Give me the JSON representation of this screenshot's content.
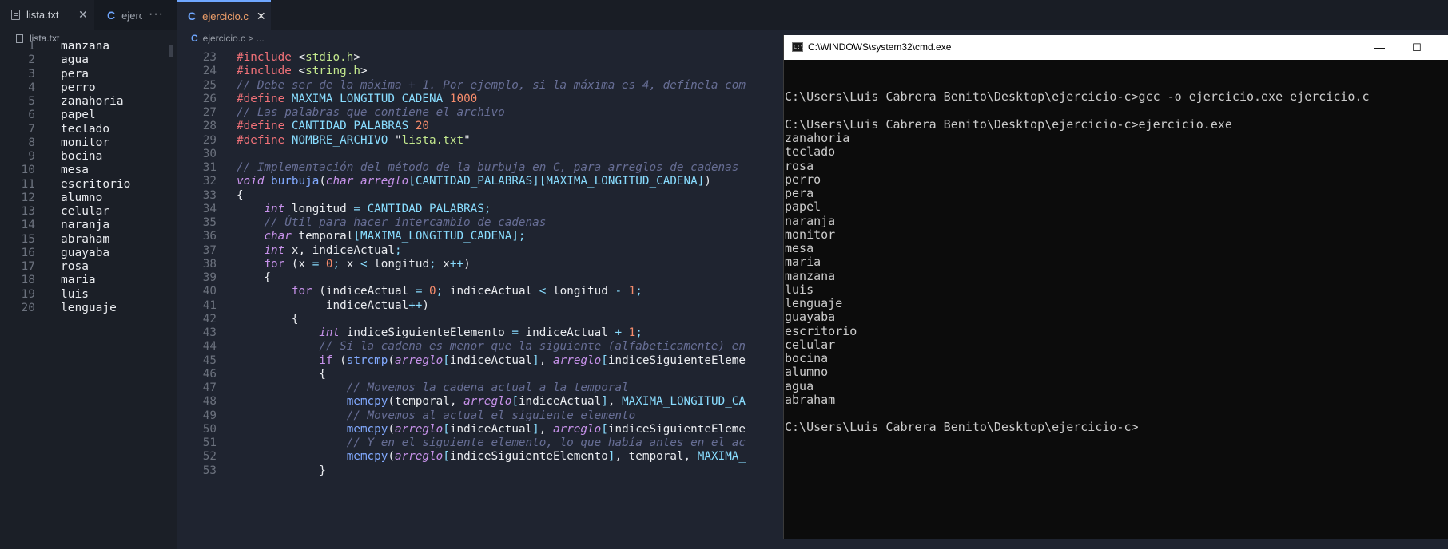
{
  "left_tabs": {
    "active_label": "lista.txt",
    "inactive_label": "ejerc",
    "more_label": "···",
    "close_glyph": "✕"
  },
  "left_breadcrumb": "lista.txt",
  "lista": [
    {
      "n": "1",
      "t": "manzana"
    },
    {
      "n": "2",
      "t": "agua"
    },
    {
      "n": "3",
      "t": "pera"
    },
    {
      "n": "4",
      "t": "perro"
    },
    {
      "n": "5",
      "t": "zanahoria"
    },
    {
      "n": "6",
      "t": "papel"
    },
    {
      "n": "7",
      "t": "teclado"
    },
    {
      "n": "8",
      "t": "monitor"
    },
    {
      "n": "9",
      "t": "bocina"
    },
    {
      "n": "10",
      "t": "mesa"
    },
    {
      "n": "11",
      "t": "escritorio"
    },
    {
      "n": "12",
      "t": "alumno"
    },
    {
      "n": "13",
      "t": "celular"
    },
    {
      "n": "14",
      "t": "naranja"
    },
    {
      "n": "15",
      "t": "abraham"
    },
    {
      "n": "16",
      "t": "guayaba"
    },
    {
      "n": "17",
      "t": "rosa"
    },
    {
      "n": "18",
      "t": "maria"
    },
    {
      "n": "19",
      "t": "luis"
    },
    {
      "n": "20",
      "t": "lenguaje"
    }
  ],
  "editor_tab": {
    "label": "ejercicio.c",
    "close_glyph": "✕"
  },
  "editor_breadcrumb": "ejercicio.c > ...",
  "code_lines": [
    {
      "n": "23",
      "tokens": [
        [
          "pp",
          "#"
        ],
        [
          "pp",
          "include"
        ],
        [
          "var",
          " <"
        ],
        [
          "hdr",
          "stdio.h"
        ],
        [
          "var",
          ">"
        ]
      ]
    },
    {
      "n": "24",
      "tokens": [
        [
          "pp",
          "#"
        ],
        [
          "pp",
          "include"
        ],
        [
          "var",
          " <"
        ],
        [
          "hdr",
          "string.h"
        ],
        [
          "var",
          ">"
        ]
      ]
    },
    {
      "n": "25",
      "tokens": [
        [
          "cm",
          "// Debe ser de la máxima + 1. Por ejemplo, si la máxima es 4, defínela com"
        ]
      ]
    },
    {
      "n": "26",
      "tokens": [
        [
          "pp",
          "#"
        ],
        [
          "pp",
          "define"
        ],
        [
          "var",
          " "
        ],
        [
          "mac",
          "MAXIMA_LONGITUD_CADENA"
        ],
        [
          "var",
          " "
        ],
        [
          "num",
          "1000"
        ]
      ]
    },
    {
      "n": "27",
      "tokens": [
        [
          "cm",
          "// Las palabras que contiene el archivo"
        ]
      ]
    },
    {
      "n": "28",
      "tokens": [
        [
          "pp",
          "#"
        ],
        [
          "pp",
          "define"
        ],
        [
          "var",
          " "
        ],
        [
          "mac",
          "CANTIDAD_PALABRAS"
        ],
        [
          "var",
          " "
        ],
        [
          "num",
          "20"
        ]
      ]
    },
    {
      "n": "29",
      "tokens": [
        [
          "pp",
          "#"
        ],
        [
          "pp",
          "define"
        ],
        [
          "var",
          " "
        ],
        [
          "mac",
          "NOMBRE_ARCHIVO"
        ],
        [
          "var",
          " \""
        ],
        [
          "str",
          "lista.txt"
        ],
        [
          "var",
          "\""
        ]
      ]
    },
    {
      "n": "30",
      "tokens": []
    },
    {
      "n": "31",
      "tokens": [
        [
          "cm",
          "// Implementación del método de la burbuja en C, para arreglos de cadenas"
        ]
      ]
    },
    {
      "n": "32",
      "tokens": [
        [
          "ty",
          "void"
        ],
        [
          "var",
          " "
        ],
        [
          "fn",
          "burbuja"
        ],
        [
          "var",
          "("
        ],
        [
          "ty",
          "char"
        ],
        [
          "var",
          " "
        ],
        [
          "ty",
          "arreglo"
        ],
        [
          "op",
          "["
        ],
        [
          "mac",
          "CANTIDAD_PALABRAS"
        ],
        [
          "op",
          "]["
        ],
        [
          "mac",
          "MAXIMA_LONGITUD_CADENA"
        ],
        [
          "op",
          "]"
        ],
        [
          "var",
          ")"
        ]
      ]
    },
    {
      "n": "33",
      "tokens": [
        [
          "var",
          "{"
        ]
      ]
    },
    {
      "n": "34",
      "tokens": [
        [
          "var",
          "    "
        ],
        [
          "ty",
          "int"
        ],
        [
          "var",
          " longitud "
        ],
        [
          "op",
          "="
        ],
        [
          "var",
          " "
        ],
        [
          "mac",
          "CANTIDAD_PALABRAS"
        ],
        [
          "op",
          ";"
        ]
      ]
    },
    {
      "n": "35",
      "tokens": [
        [
          "var",
          "    "
        ],
        [
          "cm",
          "// Útil para hacer intercambio de cadenas"
        ]
      ]
    },
    {
      "n": "36",
      "tokens": [
        [
          "var",
          "    "
        ],
        [
          "ty",
          "char"
        ],
        [
          "var",
          " temporal"
        ],
        [
          "op",
          "["
        ],
        [
          "mac",
          "MAXIMA_LONGITUD_CADENA"
        ],
        [
          "op",
          "];"
        ]
      ]
    },
    {
      "n": "37",
      "tokens": [
        [
          "var",
          "    "
        ],
        [
          "ty",
          "int"
        ],
        [
          "var",
          " x, indiceActual"
        ],
        [
          "op",
          ";"
        ]
      ]
    },
    {
      "n": "38",
      "tokens": [
        [
          "var",
          "    "
        ],
        [
          "kw",
          "for"
        ],
        [
          "var",
          " (x "
        ],
        [
          "op",
          "="
        ],
        [
          "var",
          " "
        ],
        [
          "num",
          "0"
        ],
        [
          "op",
          ";"
        ],
        [
          "var",
          " x "
        ],
        [
          "op",
          "<"
        ],
        [
          "var",
          " longitud"
        ],
        [
          "op",
          ";"
        ],
        [
          "var",
          " x"
        ],
        [
          "op",
          "++"
        ],
        [
          "var",
          ")"
        ]
      ]
    },
    {
      "n": "39",
      "tokens": [
        [
          "var",
          "    {"
        ]
      ]
    },
    {
      "n": "40",
      "tokens": [
        [
          "var",
          "        "
        ],
        [
          "kw",
          "for"
        ],
        [
          "var",
          " (indiceActual "
        ],
        [
          "op",
          "="
        ],
        [
          "var",
          " "
        ],
        [
          "num",
          "0"
        ],
        [
          "op",
          ";"
        ],
        [
          "var",
          " indiceActual "
        ],
        [
          "op",
          "<"
        ],
        [
          "var",
          " longitud "
        ],
        [
          "op",
          "-"
        ],
        [
          "var",
          " "
        ],
        [
          "num",
          "1"
        ],
        [
          "op",
          ";"
        ]
      ]
    },
    {
      "n": "41",
      "tokens": [
        [
          "var",
          "             indiceActual"
        ],
        [
          "op",
          "++"
        ],
        [
          "var",
          ")"
        ]
      ]
    },
    {
      "n": "42",
      "tokens": [
        [
          "var",
          "        {"
        ]
      ]
    },
    {
      "n": "43",
      "tokens": [
        [
          "var",
          "            "
        ],
        [
          "ty",
          "int"
        ],
        [
          "var",
          " indiceSiguienteElemento "
        ],
        [
          "op",
          "="
        ],
        [
          "var",
          " indiceActual "
        ],
        [
          "op",
          "+"
        ],
        [
          "var",
          " "
        ],
        [
          "num",
          "1"
        ],
        [
          "op",
          ";"
        ]
      ]
    },
    {
      "n": "44",
      "tokens": [
        [
          "var",
          "            "
        ],
        [
          "cm",
          "// Si la cadena es menor que la siguiente (alfabeticamente) en"
        ]
      ]
    },
    {
      "n": "45",
      "tokens": [
        [
          "var",
          "            "
        ],
        [
          "kw",
          "if"
        ],
        [
          "var",
          " ("
        ],
        [
          "fn",
          "strcmp"
        ],
        [
          "var",
          "("
        ],
        [
          "ty",
          "arreglo"
        ],
        [
          "op",
          "["
        ],
        [
          "var",
          "indiceActual"
        ],
        [
          "op",
          "]"
        ],
        [
          "var",
          ", "
        ],
        [
          "ty",
          "arreglo"
        ],
        [
          "op",
          "["
        ],
        [
          "var",
          "indiceSiguienteEleme"
        ]
      ]
    },
    {
      "n": "46",
      "tokens": [
        [
          "var",
          "            {"
        ]
      ]
    },
    {
      "n": "47",
      "tokens": [
        [
          "var",
          "                "
        ],
        [
          "cm",
          "// Movemos la cadena actual a la temporal"
        ]
      ]
    },
    {
      "n": "48",
      "tokens": [
        [
          "var",
          "                "
        ],
        [
          "fn",
          "memcpy"
        ],
        [
          "var",
          "(temporal, "
        ],
        [
          "ty",
          "arreglo"
        ],
        [
          "op",
          "["
        ],
        [
          "var",
          "indiceActual"
        ],
        [
          "op",
          "]"
        ],
        [
          "var",
          ", "
        ],
        [
          "mac",
          "MAXIMA_LONGITUD_CA"
        ]
      ]
    },
    {
      "n": "49",
      "tokens": [
        [
          "var",
          "                "
        ],
        [
          "cm",
          "// Movemos al actual el siguiente elemento"
        ]
      ]
    },
    {
      "n": "50",
      "tokens": [
        [
          "var",
          "                "
        ],
        [
          "fn",
          "memcpy"
        ],
        [
          "var",
          "("
        ],
        [
          "ty",
          "arreglo"
        ],
        [
          "op",
          "["
        ],
        [
          "var",
          "indiceActual"
        ],
        [
          "op",
          "]"
        ],
        [
          "var",
          ", "
        ],
        [
          "ty",
          "arreglo"
        ],
        [
          "op",
          "["
        ],
        [
          "var",
          "indiceSiguienteEleme"
        ]
      ]
    },
    {
      "n": "51",
      "tokens": [
        [
          "var",
          "                "
        ],
        [
          "cm",
          "// Y en el siguiente elemento, lo que había antes en el ac"
        ]
      ]
    },
    {
      "n": "52",
      "tokens": [
        [
          "var",
          "                "
        ],
        [
          "fn",
          "memcpy"
        ],
        [
          "var",
          "("
        ],
        [
          "ty",
          "arreglo"
        ],
        [
          "op",
          "["
        ],
        [
          "var",
          "indiceSiguienteElemento"
        ],
        [
          "op",
          "]"
        ],
        [
          "var",
          ", temporal, "
        ],
        [
          "mac",
          "MAXIMA_"
        ]
      ]
    },
    {
      "n": "53",
      "tokens": [
        [
          "var",
          "            }"
        ]
      ]
    }
  ],
  "cmd": {
    "title": "C:\\WINDOWS\\system32\\cmd.exe",
    "minimize_glyph": "—",
    "maximize_glyph": "☐",
    "lines": [
      "",
      "C:\\Users\\Luis Cabrera Benito\\Desktop\\ejercicio-c>gcc -o ejercicio.exe ejercicio.c",
      "",
      "C:\\Users\\Luis Cabrera Benito\\Desktop\\ejercicio-c>ejercicio.exe",
      "zanahoria",
      "teclado",
      "rosa",
      "perro",
      "pera",
      "papel",
      "naranja",
      "monitor",
      "mesa",
      "maria",
      "manzana",
      "luis",
      "lenguaje",
      "guayaba",
      "escritorio",
      "celular",
      "bocina",
      "alumno",
      "agua",
      "abraham",
      "",
      "C:\\Users\\Luis Cabrera Benito\\Desktop\\ejercicio-c>"
    ]
  }
}
